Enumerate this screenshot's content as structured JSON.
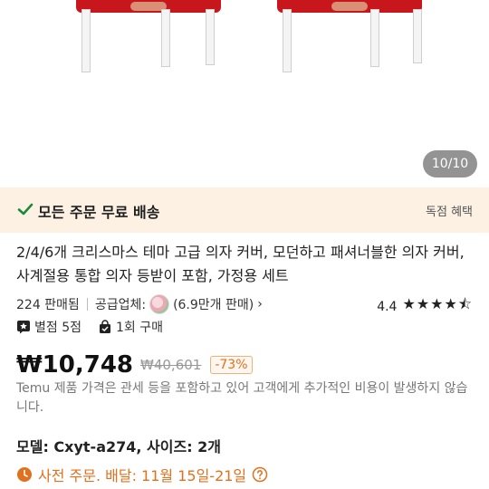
{
  "gallery": {
    "counter": "10/10"
  },
  "shipping": {
    "title": "모든 주문 무료 배송",
    "promo": "독점 혜택"
  },
  "product": {
    "title": "2/4/6개 크리스마스 테마 고급 의자 커버, 모던하고 패셔너블한 의자 커버, 사계절용 통합 의자 등받이 포함, 가정용 세트",
    "sold": "224 판매됨",
    "supplier_label": "공급업체:",
    "supplier_sales": "(6.9만개 판매)",
    "rating_value": "4.4",
    "rating_stars": "★★★★⯪",
    "reviews": "별점 5점",
    "repeat": "1회 구매"
  },
  "price": {
    "current": "₩10,748",
    "original": "₩40,601",
    "discount": "-73%",
    "note": "Temu 제품 가격은 관세 등을 포함하고 있어 고객에게 추가적인 비용이 발생하지 않습니다."
  },
  "variant": {
    "text": "모델: Cxyt-a274, 사이즈: 2개"
  },
  "delivery": {
    "text": "사전 주문. 배달: 11월 15일-21일"
  },
  "colors": {
    "accent": "#e0711e",
    "ship_bg": "#fdf1e4",
    "check": "#1a8a3a",
    "chair_red": "#c8161d"
  }
}
